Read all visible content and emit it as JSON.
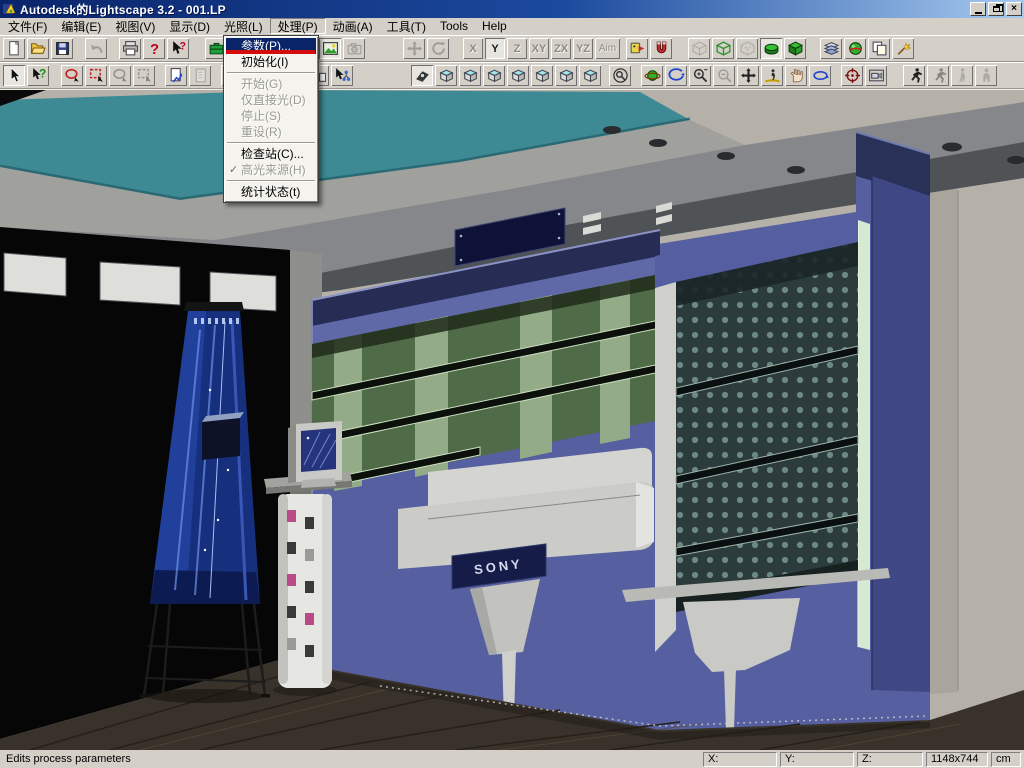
{
  "window": {
    "title": "Autodesk的Lightscape 3.2  - 001.LP"
  },
  "menu_bar": {
    "open_index": 5,
    "items": [
      {
        "id": "file",
        "label": "文件(F)"
      },
      {
        "id": "edit",
        "label": "编辑(E)"
      },
      {
        "id": "view",
        "label": "视图(V)"
      },
      {
        "id": "display",
        "label": "显示(D)"
      },
      {
        "id": "lighting",
        "label": "光照(L)"
      },
      {
        "id": "process",
        "label": "处理(P)"
      },
      {
        "id": "animation",
        "label": "动画(A)"
      },
      {
        "id": "tools-cn",
        "label": "工具(T)"
      },
      {
        "id": "tools",
        "label": "Tools"
      },
      {
        "id": "help",
        "label": "Help"
      }
    ]
  },
  "process_menu": {
    "items": [
      {
        "id": "parameters",
        "label": "参数(P)...",
        "state": "highlighted"
      },
      {
        "id": "initialize",
        "label": "初始化(I)",
        "state": "normal"
      },
      {
        "type": "separator"
      },
      {
        "id": "start",
        "label": "开始(G)",
        "state": "disabled"
      },
      {
        "id": "direct-only",
        "label": "仅直接光(D)",
        "state": "disabled"
      },
      {
        "id": "stop",
        "label": "停止(S)",
        "state": "disabled"
      },
      {
        "id": "reset",
        "label": "重设(R)",
        "state": "disabled"
      },
      {
        "type": "separator"
      },
      {
        "id": "checkpoint",
        "label": "检查站(C)...",
        "state": "normal"
      },
      {
        "id": "highlight-source",
        "label": "高光来源(H)",
        "state": "disabled",
        "checked": true
      },
      {
        "type": "separator"
      },
      {
        "id": "statistics",
        "label": "统计状态(t)",
        "state": "normal"
      }
    ]
  },
  "annotation": {
    "color": "#d40b0b"
  },
  "toolbar_standard": {
    "buttons": [
      {
        "name": "new-document",
        "icon": "new",
        "gap": 2
      },
      {
        "name": "open-file",
        "icon": "open"
      },
      {
        "name": "save-file",
        "icon": "save"
      },
      {
        "name": "undo",
        "icon": "undo",
        "state": "disabled",
        "gap": 10
      },
      {
        "name": "print",
        "icon": "print",
        "gap": 10
      },
      {
        "name": "help",
        "icon": "help"
      },
      {
        "name": "context-help",
        "icon": "ctxhelp"
      },
      {
        "name": "process-parameters",
        "icon": "briefcase",
        "gap": 14
      },
      {
        "name": "material-view",
        "icon": "image",
        "state": "pressed",
        "gap": 90
      },
      {
        "name": "snapshot-camera",
        "icon": "camera",
        "state": "disabled"
      },
      {
        "name": "pan-mode",
        "icon": "pan",
        "state": "disabled",
        "gap": 36
      },
      {
        "name": "rotate-mode",
        "icon": "rotate",
        "state": "disabled"
      },
      {
        "name": "axis-x",
        "text": "X",
        "state": "disabled",
        "gap": 12
      },
      {
        "name": "axis-y",
        "text": "Y",
        "state": "pressed"
      },
      {
        "name": "axis-z",
        "text": "Z",
        "state": "disabled"
      },
      {
        "name": "axis-xy",
        "text": "XY",
        "state": "disabled"
      },
      {
        "name": "axis-zx",
        "text": "ZX",
        "state": "disabled"
      },
      {
        "name": "axis-yz",
        "text": "YZ",
        "state": "disabled"
      },
      {
        "name": "axis-aim",
        "text": "Aim",
        "state": "disabled",
        "wide": true
      },
      {
        "name": "surface-properties",
        "icon": "mask",
        "gap": 4
      },
      {
        "name": "snap-magnet",
        "icon": "magnet"
      },
      {
        "name": "wireframe-mode",
        "icon": "cubewiregray",
        "state": "disabled",
        "gap": 14
      },
      {
        "name": "wireframe-cube",
        "icon": "cubewire"
      },
      {
        "name": "hidden-line-mode",
        "icon": "cubehidden",
        "state": "disabled"
      },
      {
        "name": "solid-shaded-mode",
        "icon": "solidflat",
        "state": "pressed"
      },
      {
        "name": "solid-cube-mode",
        "icon": "cubesolid"
      },
      {
        "name": "layers",
        "icon": "layers",
        "gap": 12
      },
      {
        "name": "render-sphere",
        "icon": "sphererender"
      },
      {
        "name": "duplicate-view",
        "icon": "copy"
      },
      {
        "name": "enhance-wand",
        "icon": "wand"
      }
    ]
  },
  "toolbar_view": {
    "buttons": [
      {
        "name": "select-arrow",
        "icon": "arrow",
        "state": "pressed",
        "gap": 2
      },
      {
        "name": "query-select",
        "icon": "queryarrow"
      },
      {
        "name": "lasso-select",
        "icon": "lasso",
        "gap": 10
      },
      {
        "name": "fence-select",
        "icon": "zoombox"
      },
      {
        "name": "lasso-select-alt",
        "icon": "lasso",
        "state": "disabled"
      },
      {
        "name": "fence-select-alt",
        "icon": "zoombox",
        "state": "disabled"
      },
      {
        "name": "export-page",
        "icon": "pagearrow",
        "gap": 8
      },
      {
        "name": "import-page",
        "icon": "page",
        "state": "disabled"
      },
      {
        "name": "board-select",
        "icon": "boardarrow",
        "gap": 8
      },
      {
        "name": "board-help",
        "icon": "boardhelp"
      },
      {
        "name": "select-by-page",
        "icon": "cursorpage",
        "gap": 38
      },
      {
        "name": "select-hierarchy",
        "icon": "cursortree"
      },
      {
        "name": "camera-view-tool",
        "icon": "viewtool",
        "state": "pressed",
        "gap": 56
      },
      {
        "name": "iso-view-1",
        "icon": "cubeview"
      },
      {
        "name": "iso-view-2",
        "icon": "cubeview"
      },
      {
        "name": "iso-view-3",
        "icon": "cubeview"
      },
      {
        "name": "iso-view-4",
        "icon": "cubeview"
      },
      {
        "name": "iso-view-5",
        "icon": "cubeview"
      },
      {
        "name": "iso-view-6",
        "icon": "cubeview"
      },
      {
        "name": "iso-view-7",
        "icon": "cubeview"
      },
      {
        "name": "region-zoom",
        "icon": "circlezoom",
        "gap": 6
      },
      {
        "name": "orbit-sphere",
        "icon": "orbitsphere",
        "gap": 8
      },
      {
        "name": "orbit-rotate",
        "icon": "orbitarrow"
      },
      {
        "name": "zoom-in-out",
        "icon": "zoompm"
      },
      {
        "name": "zoom-extents",
        "icon": "zoomout",
        "state": "disabled"
      },
      {
        "name": "pan-view",
        "icon": "pancross"
      },
      {
        "name": "walk-through",
        "icon": "walk"
      },
      {
        "name": "hand-drag",
        "icon": "handpoint"
      },
      {
        "name": "orbit-loop",
        "icon": "orbitloop"
      },
      {
        "name": "target-zoom",
        "icon": "targetzoom",
        "gap": 8
      },
      {
        "name": "camera-frame",
        "icon": "camframe"
      },
      {
        "name": "run-motion",
        "icon": "runner",
        "gap": 14
      },
      {
        "name": "run-motion-alt",
        "icon": "runner",
        "state": "disabled"
      },
      {
        "name": "walk-motion",
        "icon": "walker",
        "state": "disabled"
      },
      {
        "name": "stand-motion",
        "icon": "person",
        "state": "disabled"
      }
    ]
  },
  "status_bar": {
    "message": "Edits process parameters",
    "x_label": "X:",
    "y_label": "Y:",
    "z_label": "Z:",
    "resolution": "1148x744",
    "units": "cm"
  },
  "scene": {
    "sony_label": "SONY",
    "colors": {
      "ceiling_teal": "#3e8a94",
      "ceiling_gray": "#a0a09c",
      "ceiling_dark": "#4f5356",
      "wall": "#b5b1a8",
      "left_wall": "#060606",
      "cabinet_blue": "#5660a1",
      "cabinet_navy": "#262c54",
      "shelf_green": "#4f6b48",
      "shelf_green_light": "#93ab86",
      "perforated_panel": "#2c3b3c",
      "perforated_dot": "#7d9c97",
      "glass_edge": "#d6ead2",
      "counter_white": "#cbcbc7",
      "sony_plaque": "#151c48",
      "banner_blue": "#16307e",
      "floor": "#39322a"
    }
  }
}
